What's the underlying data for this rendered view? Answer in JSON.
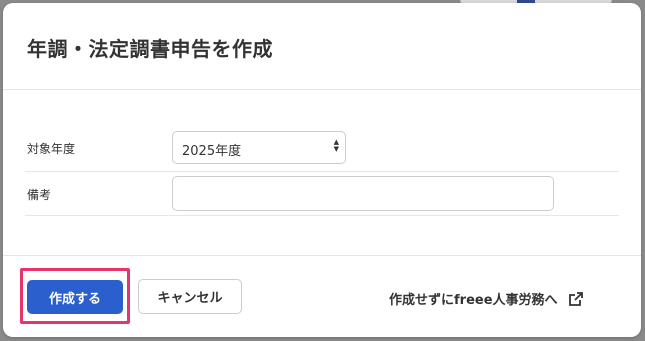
{
  "dialog": {
    "title": "年調・法定調書申告を作成",
    "fields": {
      "year": {
        "label": "対象年度",
        "value": "2025年度"
      },
      "remarks": {
        "label": "備考",
        "value": ""
      }
    },
    "buttons": {
      "create": "作成する",
      "cancel": "キャンセル",
      "external_link": "作成せずにfreee人事労務へ"
    }
  },
  "colors": {
    "primary_button": "#2b5fce",
    "highlight_border": "#e8336d"
  }
}
